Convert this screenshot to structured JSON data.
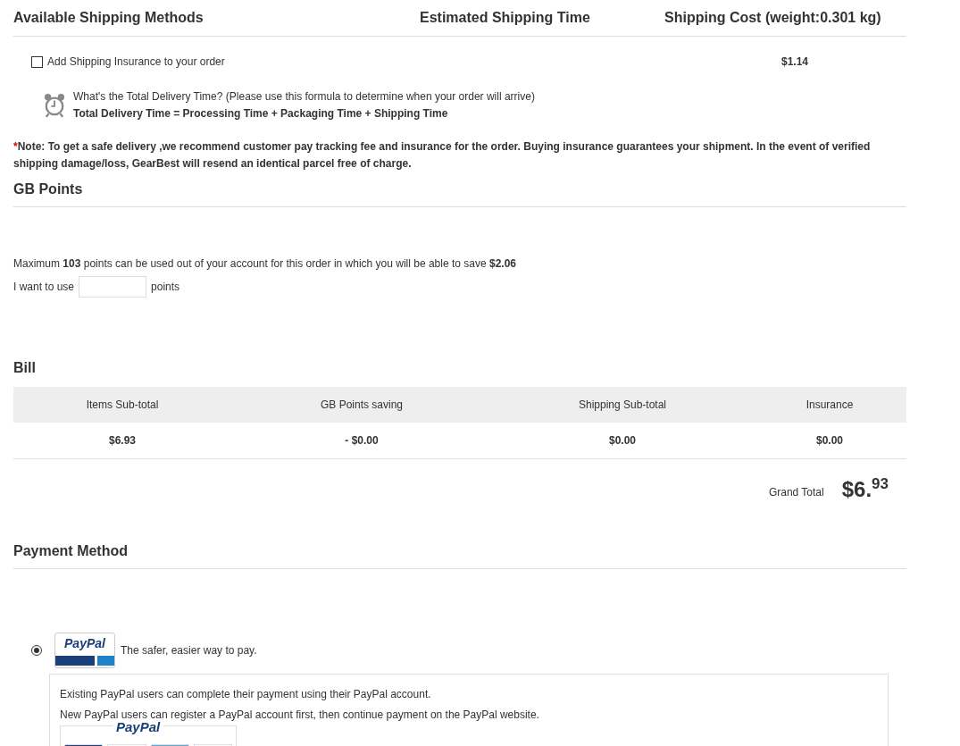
{
  "shipping": {
    "headers": [
      "Available Shipping Methods",
      "Estimated Shipping Time",
      "Shipping Cost (weight:0.301 kg)"
    ],
    "insurance": {
      "label": "Add Shipping Insurance to your order",
      "checked": false,
      "price": "$1.14"
    },
    "delivery_question": "What's the Total Delivery Time? (Please use this formula to determine when your order will arrive)",
    "delivery_formula": "Total Delivery Time = Processing Time + Packaging Time + Shipping Time",
    "note_mark": "*",
    "note": "Note: To get a safe delivery ,we recommend customer pay tracking fee and insurance for the order. Buying insurance guarantees your shipment. In the event of verified shipping damage/loss, GearBest will resend an identical parcel free of charge."
  },
  "points": {
    "title": "GB Points",
    "info": "Maximum **103** points can be used out of your account for this order in which you will be able to save **$2.06**",
    "prefix": "I want to use",
    "suffix": "points"
  },
  "bill": {
    "title": "Bill",
    "columns": [
      "Items Sub-total",
      "GB Points saving",
      "Shipping Sub-total",
      "Insurance"
    ],
    "values": [
      "$6.93",
      "- $0.00",
      "$0.00",
      "$0.00"
    ],
    "grand_total_label": "Grand Total",
    "grand_total_main": "$6.",
    "grand_total_cents": "93"
  },
  "payment": {
    "title": "Payment Method",
    "options": [
      {
        "selected": true,
        "logo": "PayPal",
        "tagline": "The safer, easier way to pay.",
        "details": [
          "Existing PayPal users can complete their payment using their PayPal account.",
          "New PayPal users can register a PayPal account first, then continue payment on the PayPal website."
        ],
        "banner_logo": "PayPal"
      }
    ]
  }
}
